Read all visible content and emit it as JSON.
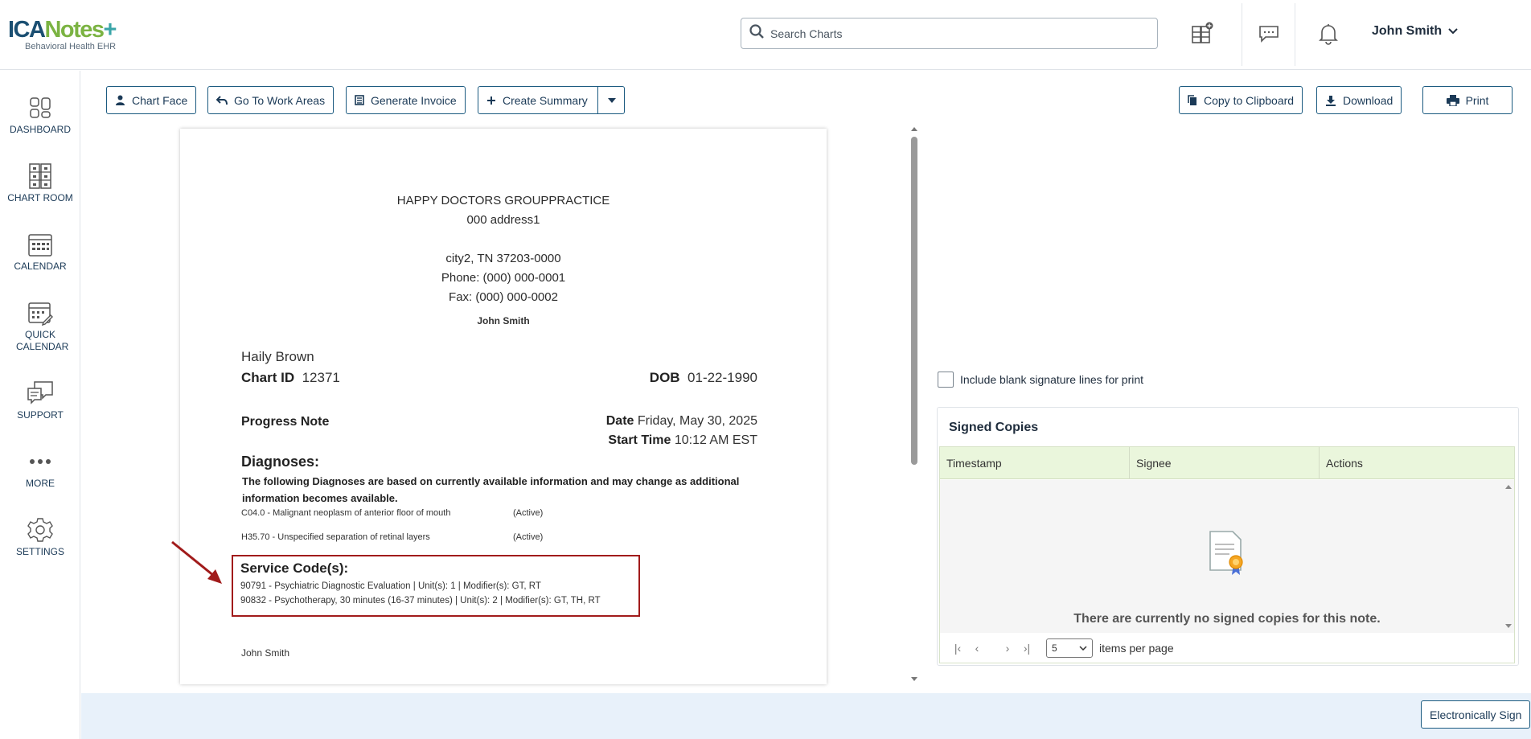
{
  "header": {
    "logo_text_a": "ICA",
    "logo_text_b": "Notes",
    "logo_text_c": "+",
    "logo_subtitle": "Behavioral Health EHR",
    "search_placeholder": "Search Charts",
    "user_name": "John Smith"
  },
  "sidebar": {
    "items": [
      {
        "label": "DASHBOARD",
        "icon": "dashboard-icon"
      },
      {
        "label": "CHART ROOM",
        "icon": "chart-room-icon"
      },
      {
        "label": "CALENDAR",
        "icon": "calendar-icon"
      },
      {
        "label": "QUICK CALENDAR",
        "icon": "quick-calendar-icon"
      },
      {
        "label": "SUPPORT",
        "icon": "support-icon"
      },
      {
        "label": "MORE",
        "icon": "more-icon"
      },
      {
        "label": "SETTINGS",
        "icon": "gear-icon"
      }
    ]
  },
  "toolbar": {
    "chart_face": "Chart Face",
    "go_to_work_areas": "Go To Work Areas",
    "generate_invoice": "Generate Invoice",
    "create_summary": "Create Summary",
    "copy_to_clipboard": "Copy to Clipboard",
    "download": "Download",
    "print": "Print"
  },
  "document": {
    "practice_name": "HAPPY DOCTORS GROUPPRACTICE",
    "address1": "000 address1",
    "city_state_zip": "city2, TN 37203-0000",
    "phone": "Phone: (000) 000-0001",
    "fax": "Fax: (000) 000-0002",
    "provider": "John Smith",
    "patient_name": "Haily Brown",
    "chart_id_label": "Chart ID",
    "chart_id": "12371",
    "dob_label": "DOB",
    "dob": "01-22-1990",
    "note_type": "Progress Note",
    "date_label": "Date",
    "date": "Friday, May 30, 2025",
    "start_time_label": "Start Time",
    "start_time": "10:12 AM EST",
    "diagnoses_title": "Diagnoses:",
    "diagnoses_note": "The following Diagnoses are based on currently available information and may change as additional information becomes available.",
    "diagnoses": [
      {
        "code": "C04.0 - Malignant neoplasm of anterior floor of mouth",
        "status": "(Active)"
      },
      {
        "code": "H35.70 - Unspecified separation of retinal layers",
        "status": "(Active)"
      }
    ],
    "service_codes_title": "Service Code(s):",
    "service_codes": [
      "90791 - Psychiatric Diagnostic Evaluation | Unit(s): 1 | Modifier(s): GT, RT",
      "90832 - Psychotherapy, 30 minutes (16-37 minutes) | Unit(s): 2 | Modifier(s): GT, TH, RT"
    ],
    "signature_name": "John Smith"
  },
  "right_panel": {
    "include_blank_label": "Include blank signature lines for print",
    "signed_copies_title": "Signed Copies",
    "columns": [
      "Timestamp",
      "Signee",
      "Actions"
    ],
    "empty_message": "There are currently no signed copies for this note.",
    "page_size": "5",
    "items_per_page": "items per page"
  },
  "footer": {
    "electronically_sign": "Electronically Sign"
  },
  "colors": {
    "brand_navy": "#1b4f72",
    "brand_green": "#7bb342",
    "annotation_red": "#a11b1b",
    "grid_header_green": "#eaf6dc",
    "bottom_bar": "#e8f1fa"
  }
}
